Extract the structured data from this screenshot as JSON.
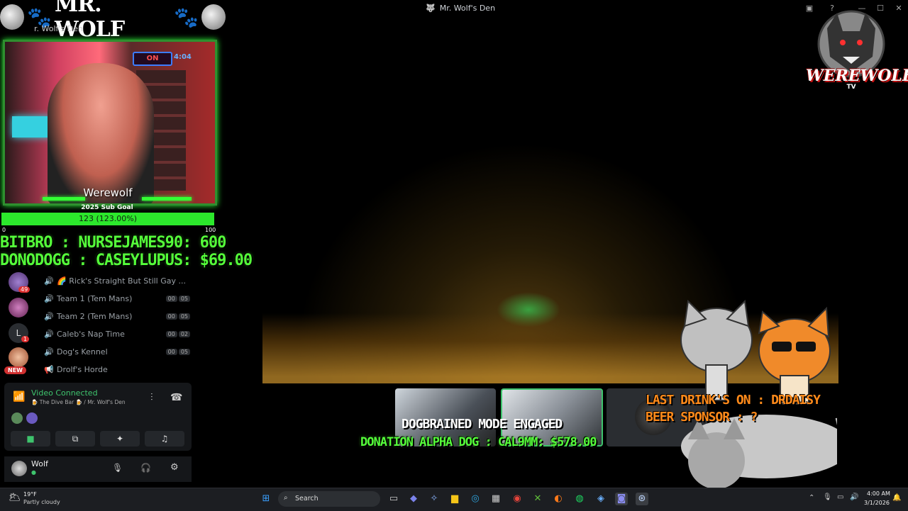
{
  "window": {
    "title": "Mr. Wolf's Den"
  },
  "overlay": {
    "brand_title": "MR. WOLF",
    "server_name": "r. Wolf's Den",
    "webcam_label": "Werewolf",
    "webcam_sign": "ON",
    "webcam_clock": "4:04",
    "sub_goal": {
      "title": "2025 Sub Goal",
      "progress_text": "123 (123.00%)",
      "min": "0",
      "max": "100",
      "progress_fraction": 1.0
    },
    "bits_line": "BITBRO : NURSEJAMES90: 600",
    "dono_line": "DONODOGG : CASEYLUPUS: $69.00",
    "dog_mode": "DOGBRAINED MODE ENGAGED",
    "donation_alpha": "DONATION ALPHA DOG : CAL9MM: $578.00",
    "drink_line": "LAST DRINK'S ON : DRDAISY",
    "beer_line": "BEER SPONSOR : ?",
    "wolf_logo_text": "WEREWOLF",
    "wolf_logo_sub": "TV"
  },
  "rail": {
    "badges": [
      "49",
      "1"
    ],
    "letter": "L",
    "new_label": "NEW"
  },
  "channels": [
    {
      "name": "🌈 Rick's Straight But Still Gay ...",
      "a": "",
      "b": ""
    },
    {
      "name": "Team 1 (Tem Mans)",
      "a": "00",
      "b": "05"
    },
    {
      "name": "Team 2 (Tem Mans)",
      "a": "00",
      "b": "05"
    },
    {
      "name": "Caleb's Nap Time",
      "a": "00",
      "b": "02"
    },
    {
      "name": "Dog's Kennel",
      "a": "00",
      "b": "05"
    },
    {
      "name": "Drolf's Horde",
      "a": "",
      "b": ""
    }
  ],
  "voice": {
    "status": "Video Connected",
    "sub": "🍺 The Dive Bar 🍺 / Mr. Wolf's Den"
  },
  "user": {
    "name": "Wolf"
  },
  "taskbar": {
    "weather_temp": "19°F",
    "weather_desc": "Partly cloudy",
    "search_label": "Search",
    "time": "4:00 AM",
    "date": "3/1/2026"
  },
  "colors": {
    "neon_green": "#55ff3a",
    "orange": "#ff8a1a",
    "voice_green": "#3ec46d"
  }
}
